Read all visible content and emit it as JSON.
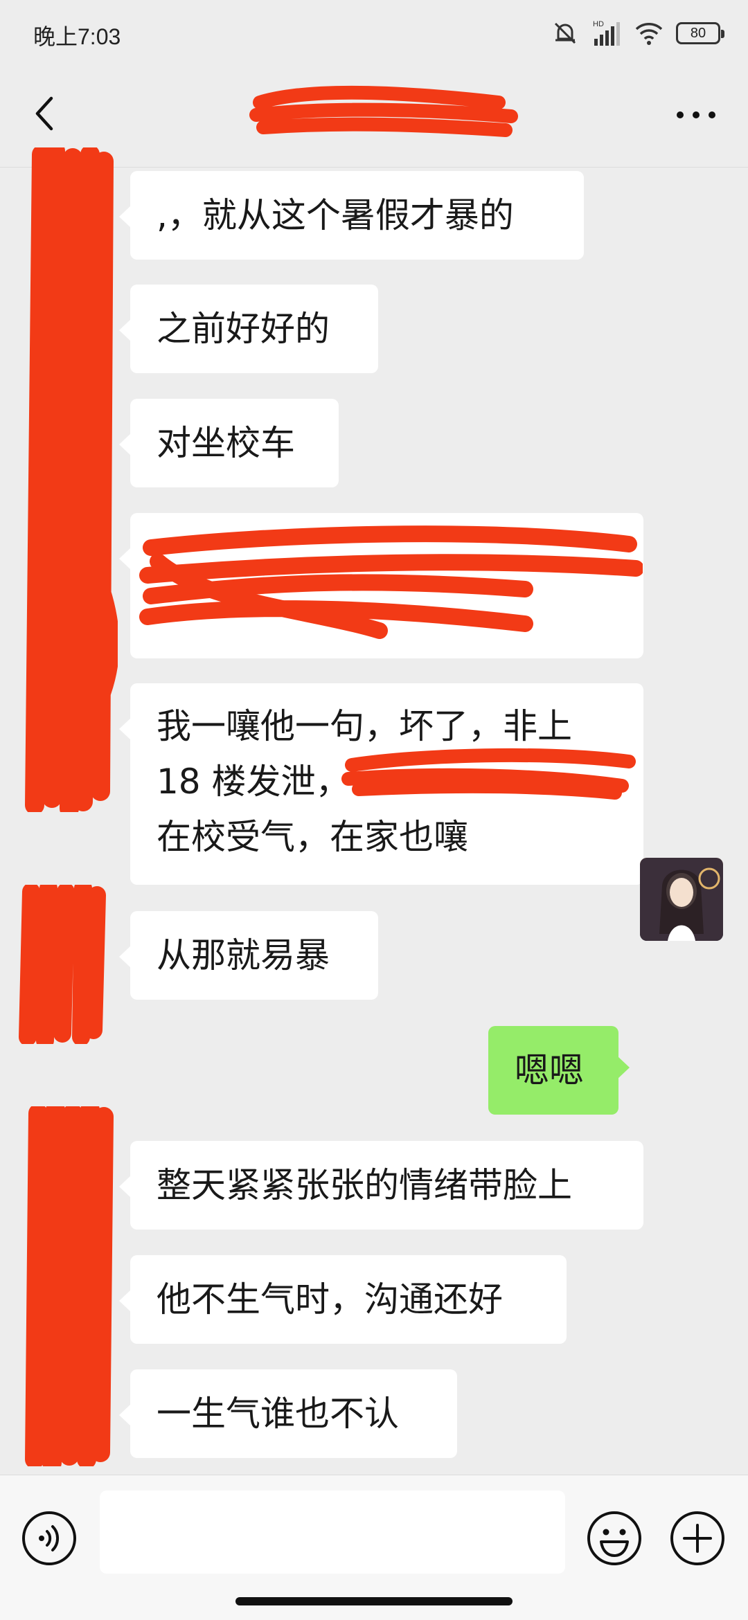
{
  "status_bar": {
    "time": "晚上7:03",
    "battery": "80",
    "network_label": "HD"
  },
  "icons": {
    "back": "chevron-left-icon",
    "more": "more-dots-icon",
    "voice": "voice-icon",
    "emoji": "emoji-icon",
    "plus": "plus-icon",
    "mute": "mute-bell-icon",
    "signal": "signal-icon",
    "wifi": "wifi-icon"
  },
  "colors": {
    "redaction": "#f23a16",
    "sent_bubble": "#95ec69",
    "received_bubble": "#ffffff",
    "background": "#ededed"
  },
  "messages": [
    {
      "side": "left",
      "lines": [
        ",，就从这个暑假才暴的"
      ]
    },
    {
      "side": "left",
      "lines": [
        "之前好好的"
      ]
    },
    {
      "side": "left",
      "lines": [
        "对坐校车"
      ]
    },
    {
      "side": "left",
      "lines": [],
      "redacted": true
    },
    {
      "side": "left",
      "lines": [
        "我一嚷他一句，坏了，非上",
        "18 楼发泄，",
        "在校受气，在家也嚷"
      ]
    },
    {
      "side": "left",
      "lines": [
        "从那就易暴"
      ]
    },
    {
      "side": "right",
      "lines": [
        "嗯嗯"
      ]
    },
    {
      "side": "left",
      "lines": [
        "整天紧紧张张的情绪带脸上"
      ]
    },
    {
      "side": "left",
      "lines": [
        "他不生气时，沟通还好"
      ]
    },
    {
      "side": "left",
      "lines": [
        "一生气谁也不认"
      ]
    }
  ],
  "input": {
    "value": "",
    "placeholder": ""
  }
}
